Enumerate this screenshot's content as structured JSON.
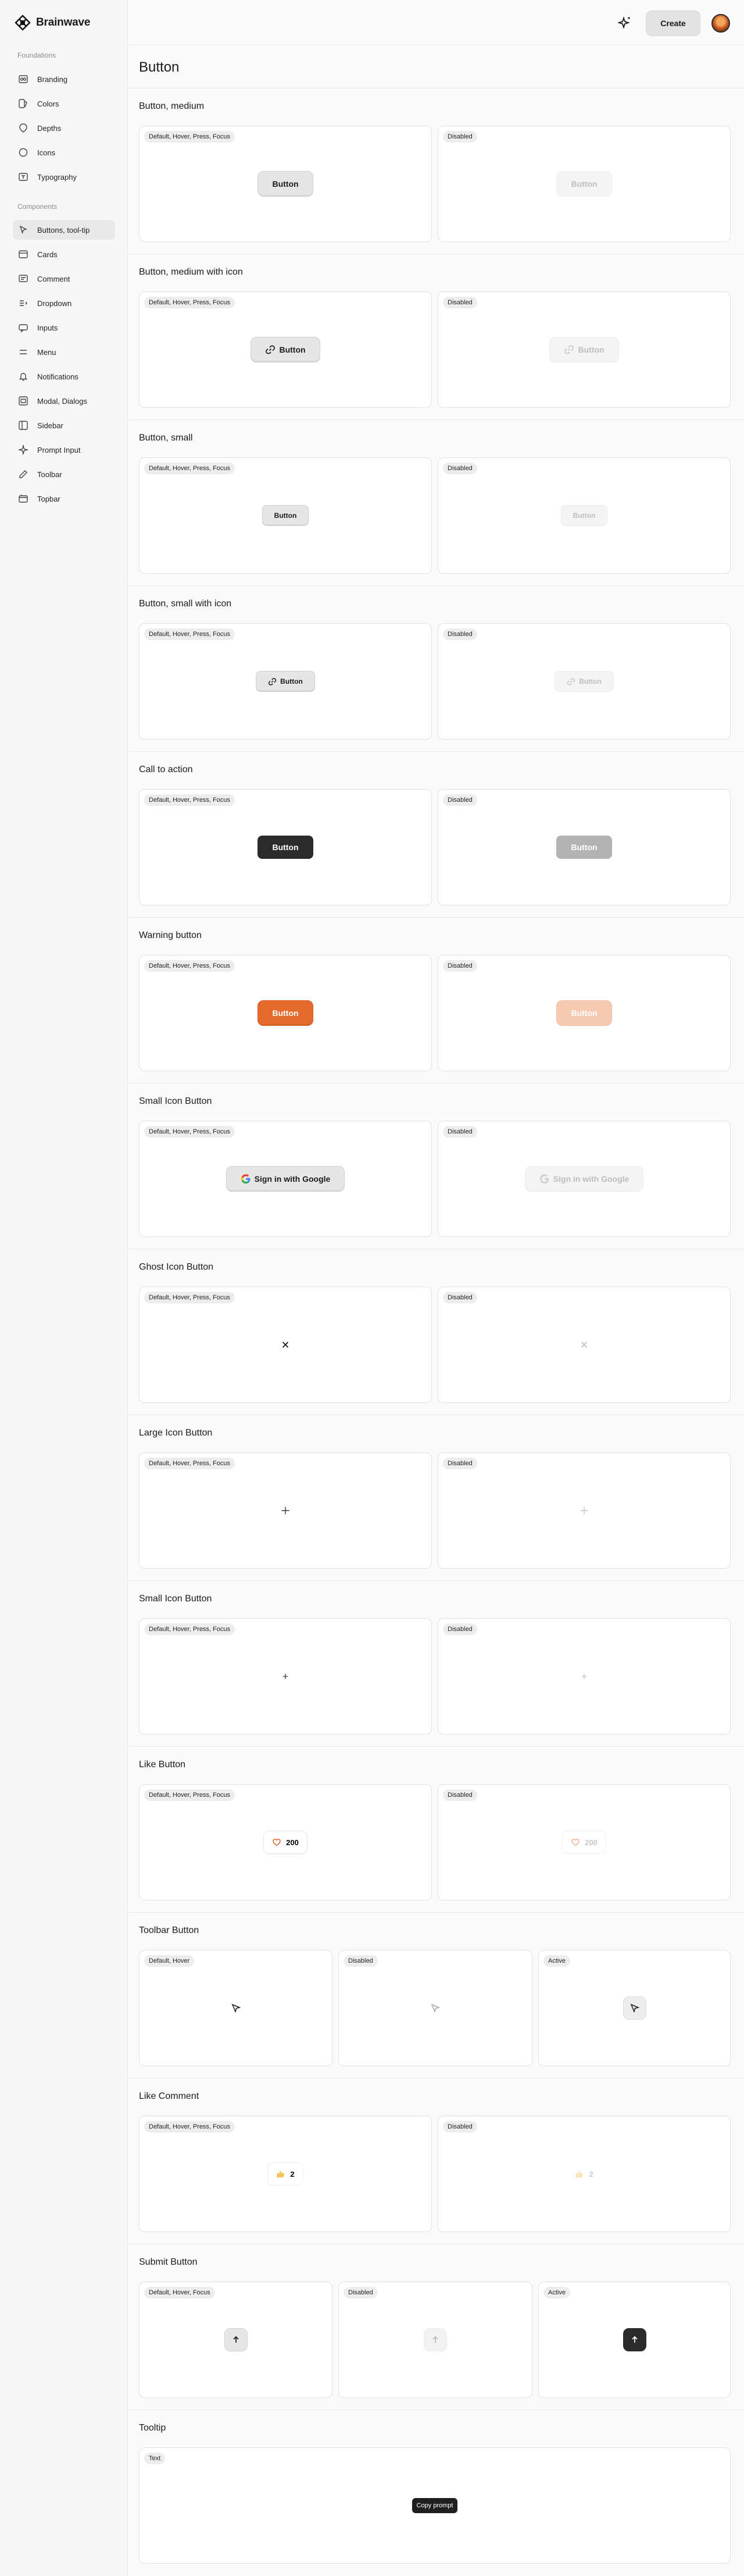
{
  "app": {
    "name": "Brainwave"
  },
  "topbar": {
    "create_label": "Create"
  },
  "page": {
    "title": "Button"
  },
  "sidebar": {
    "foundations_label": "Foundations",
    "components_label": "Components",
    "foundations": [
      {
        "label": "Branding",
        "icon": "branding-icon"
      },
      {
        "label": "Colors",
        "icon": "colors-icon"
      },
      {
        "label": "Depths",
        "icon": "depths-icon"
      },
      {
        "label": "Icons",
        "icon": "icons-icon"
      },
      {
        "label": "Typography",
        "icon": "typography-icon"
      }
    ],
    "components": [
      {
        "label": "Buttons, tool-tip",
        "icon": "button-icon",
        "active": true
      },
      {
        "label": "Cards",
        "icon": "cards-icon"
      },
      {
        "label": "Comment",
        "icon": "comment-icon"
      },
      {
        "label": "Dropdown",
        "icon": "dropdown-icon"
      },
      {
        "label": "Inputs",
        "icon": "inputs-icon"
      },
      {
        "label": "Menu",
        "icon": "menu-icon"
      },
      {
        "label": "Notifications",
        "icon": "bell-icon"
      },
      {
        "label": "Modal, Dialogs",
        "icon": "modal-icon"
      },
      {
        "label": "Sidebar",
        "icon": "sidebar-icon"
      },
      {
        "label": "Prompt Input",
        "icon": "prompt-icon"
      },
      {
        "label": "Toolbar",
        "icon": "toolbar-icon"
      },
      {
        "label": "Topbar",
        "icon": "topbar-icon"
      }
    ]
  },
  "states": {
    "default_all": "Default, Hover, Press, Focus",
    "default_hover": "Default, Hover",
    "default_hover_focus": "Default, Hover, Focus",
    "disabled": "Disabled",
    "active": "Active",
    "text": "Text"
  },
  "sections": {
    "medium": {
      "title": "Button, medium",
      "label": "Button"
    },
    "medium_icon": {
      "title": "Button, medium with icon",
      "label": "Button"
    },
    "small": {
      "title": "Button, small",
      "label": "Button"
    },
    "small_icon": {
      "title": "Button, small with icon",
      "label": "Button"
    },
    "cta": {
      "title": "Call to action",
      "label": "Button"
    },
    "warning": {
      "title": "Warning button",
      "label": "Button"
    },
    "google": {
      "title": "Small Icon Button",
      "label": "Sign in with Google"
    },
    "ghost": {
      "title": "Ghost Icon Button"
    },
    "large_icon": {
      "title": "Large Icon Button"
    },
    "small_icon_btn": {
      "title": "Small Icon Button"
    },
    "like": {
      "title": "Like Button",
      "count": "200"
    },
    "toolbar": {
      "title": "Toolbar Button"
    },
    "like_comment": {
      "title": "Like Comment",
      "count": "2"
    },
    "submit": {
      "title": "Submit Button"
    },
    "tooltip": {
      "title": "Tooltip",
      "text": "Copy prompt"
    }
  }
}
